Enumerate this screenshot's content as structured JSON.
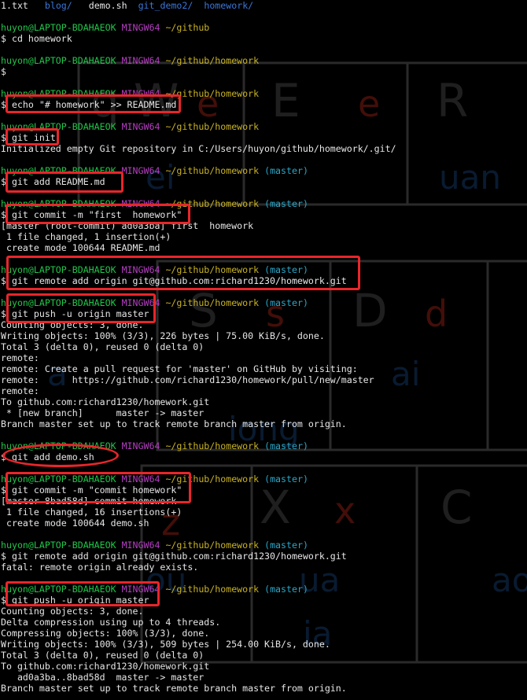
{
  "listing": [
    "1.txt",
    "blog/",
    "demo.sh",
    "git_demo2/",
    "homework/"
  ],
  "prompt": {
    "user_host": "huyon@LAPTOP-BDAHAEOK",
    "shell": "MINGW64"
  },
  "blocks": [
    {
      "path": "~/github",
      "branch": "",
      "cmd": "cd homework",
      "output": []
    },
    {
      "path": "~/github/homework",
      "branch": "",
      "cmd": "",
      "output": []
    },
    {
      "path": "~/github/homework",
      "branch": "",
      "cmd": "echo \"# homework\" >> README.md",
      "output": []
    },
    {
      "path": "~/github/homework",
      "branch": "",
      "cmd": "git init",
      "output": [
        "Initialized empty Git repository in C:/Users/huyon/github/homework/.git/"
      ]
    },
    {
      "path": "~/github/homework",
      "branch": "(master)",
      "cmd": "git add README.md",
      "output": []
    },
    {
      "path": "~/github/homework",
      "branch": "(master)",
      "cmd": "git commit -m \"first  homework\"",
      "output": [
        "[master (root-commit) ad0a3ba] first  homework",
        " 1 file changed, 1 insertion(+)",
        " create mode 100644 README.md"
      ]
    },
    {
      "path": "~/github/homework",
      "branch": "(master)",
      "cmd": "git remote add origin git@github.com:richard1230/homework.git",
      "output": []
    },
    {
      "path": "~/github/homework",
      "branch": "(master)",
      "cmd": "git push -u origin master",
      "output": [
        "Counting objects: 3, done.",
        "Writing objects: 100% (3/3), 226 bytes | 75.00 KiB/s, done.",
        "Total 3 (delta 0), reused 0 (delta 0)",
        "remote:",
        "remote: Create a pull request for 'master' on GitHub by visiting:",
        "remote:      https://github.com/richard1230/homework/pull/new/master",
        "remote:",
        "To github.com:richard1230/homework.git",
        " * [new branch]      master -> master",
        "Branch master set up to track remote branch master from origin."
      ]
    },
    {
      "path": "~/github/homework",
      "branch": "(master)",
      "cmd": "git add demo.sh",
      "output": []
    },
    {
      "path": "~/github/homework",
      "branch": "(master)",
      "cmd": "git commit -m \"commit homework\"",
      "output": [
        "[master 8bad58d] commit homework",
        " 1 file changed, 16 insertions(+)",
        " create mode 100644 demo.sh"
      ]
    },
    {
      "path": "~/github/homework",
      "branch": "(master)",
      "cmd": "git remote add origin git@github.com:richard1230/homework.git",
      "output": [
        "fatal: remote origin already exists."
      ]
    },
    {
      "path": "~/github/homework",
      "branch": "(master)",
      "cmd": "git push -u origin master",
      "output": [
        "Counting objects: 3, done.",
        "Delta compression using up to 4 threads.",
        "Compressing objects: 100% (3/3), done.",
        "Writing objects: 100% (3/3), 509 bytes | 254.00 KiB/s, done.",
        "Total 3 (delta 0), reused 0 (delta 0)",
        "To github.com:richard1230/homework.git",
        "   ad0a3ba..8bad58d  master -> master",
        "Branch master set up to track remote branch master from origin."
      ]
    }
  ],
  "wallpaper_glyphs": [
    "q",
    "W",
    "e",
    "E",
    "e",
    "R",
    "ei",
    "uan",
    "S",
    "s",
    "D",
    "d",
    "a",
    "ai",
    "iong",
    "z",
    "X",
    "x",
    "C",
    "ou",
    "ua",
    "ao",
    "ia"
  ],
  "colors": {
    "background": "#000000",
    "user_host": "#22c54a",
    "shell": "#b43fc0",
    "path": "#c8b224",
    "branch": "#2aa7c8",
    "annotation": "#e8262a"
  }
}
